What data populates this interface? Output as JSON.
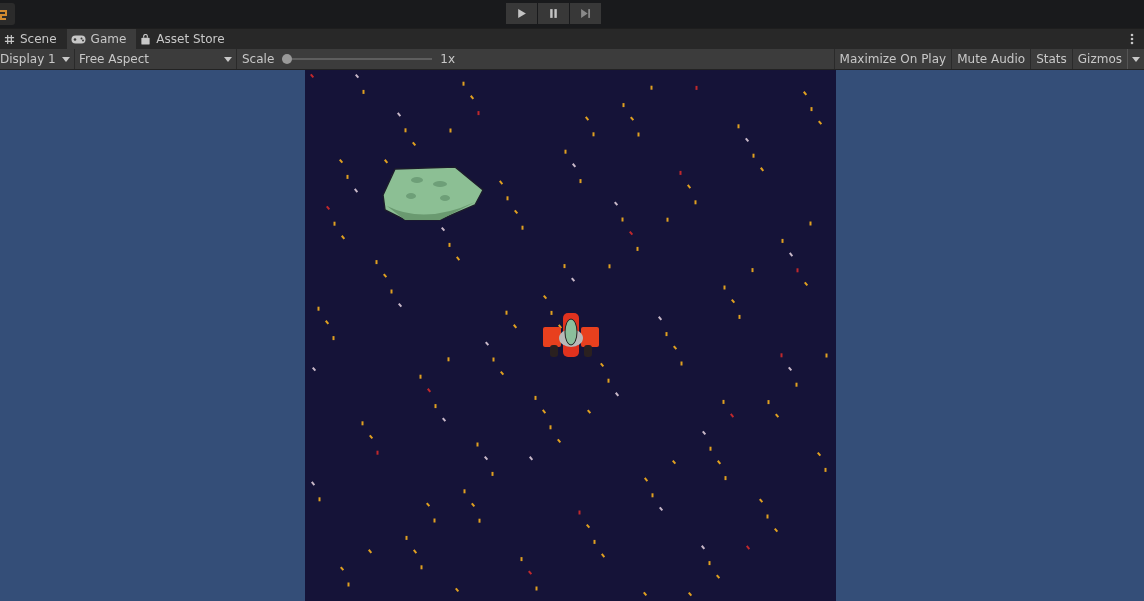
{
  "toolbar": {
    "play_buttons": [
      {
        "kind": "play"
      },
      {
        "kind": "pause"
      },
      {
        "kind": "step"
      }
    ]
  },
  "tabs": [
    {
      "label": "Scene",
      "kind": "scene",
      "selected": false
    },
    {
      "label": "Game",
      "kind": "game",
      "selected": true
    },
    {
      "label": "Asset Store",
      "kind": "store",
      "selected": false
    }
  ],
  "game_toolbar": {
    "display": "Display 1",
    "aspect": "Free Aspect",
    "scale_label": "Scale",
    "scale": {
      "level": 0,
      "reading": "1x"
    },
    "toggles": [
      {
        "label": "Maximize On Play",
        "on": false
      },
      {
        "label": "Mute Audio",
        "on": false
      },
      {
        "label": "Stats",
        "on": false
      },
      {
        "label": "Gizmos",
        "on": false
      }
    ]
  }
}
